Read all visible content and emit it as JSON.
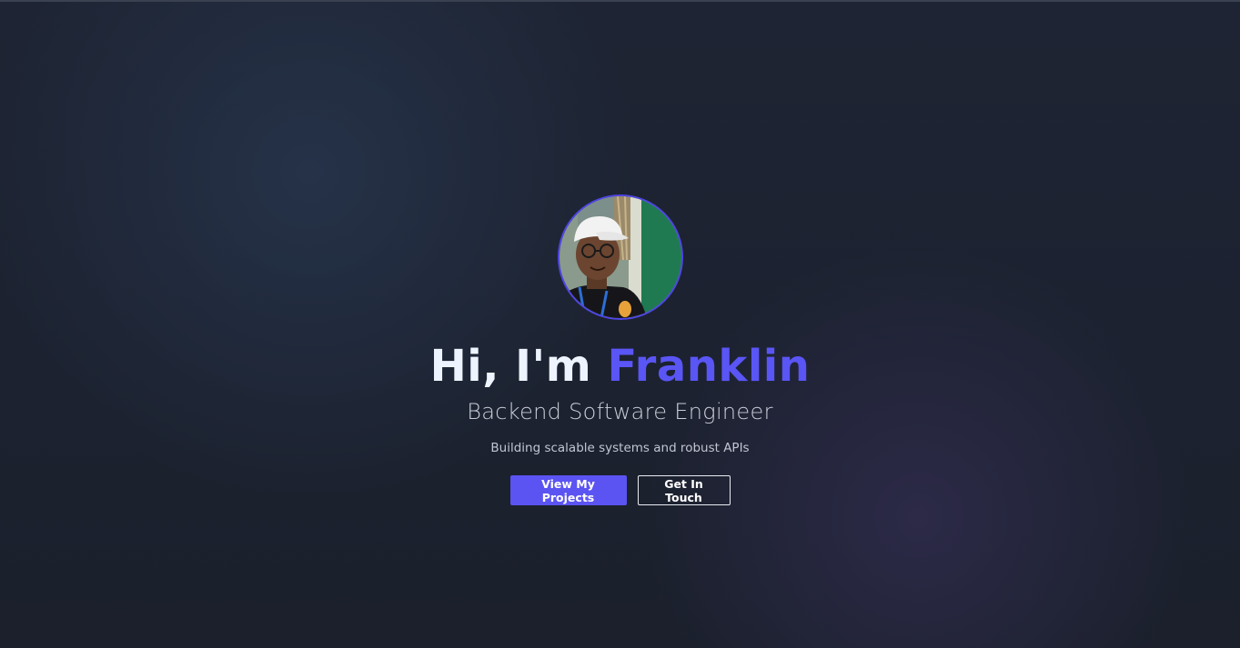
{
  "hero": {
    "greeting": "Hi, I'm ",
    "name": "Franklin",
    "role": "Backend Software Engineer",
    "tagline": "Building scalable systems and robust APIs"
  },
  "buttons": {
    "primary_label": "View My Projects",
    "secondary_label": "Get In Touch"
  },
  "colors": {
    "accent": "#5b54f2",
    "background": "#1d2330",
    "heading": "#eef4ff"
  },
  "avatar": {
    "alt": "Franklin profile photo"
  }
}
